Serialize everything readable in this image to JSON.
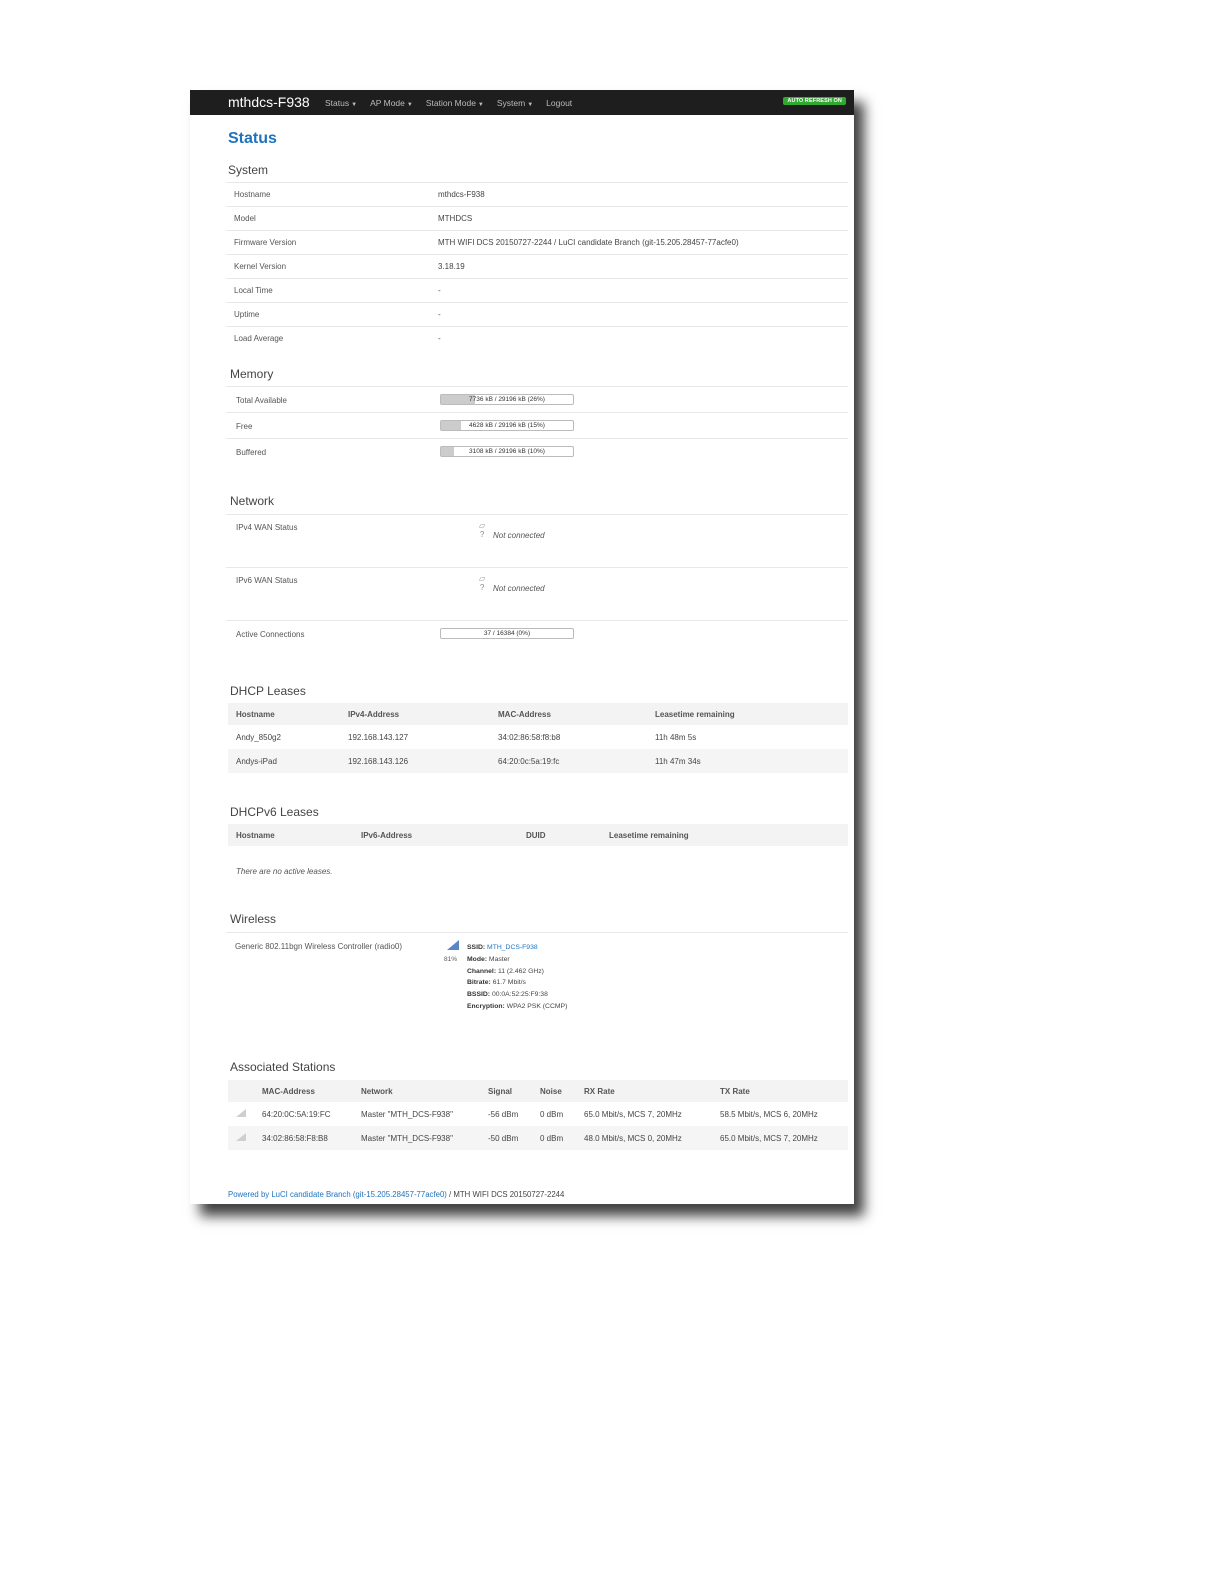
{
  "navbar": {
    "brand": "mthdcs-F938",
    "items": [
      "Status",
      "AP Mode",
      "Station Mode",
      "System",
      "Logout"
    ],
    "auto_refresh": "AUTO REFRESH ON"
  },
  "page_title": "Status",
  "system": {
    "title": "System",
    "rows": [
      {
        "label": "Hostname",
        "value": "mthdcs-F938"
      },
      {
        "label": "Model",
        "value": "MTHDCS"
      },
      {
        "label": "Firmware Version",
        "value": "MTH WIFI DCS 20150727-2244 / LuCI candidate Branch (git-15.205.28457-77acfe0)"
      },
      {
        "label": "Kernel Version",
        "value": "3.18.19"
      },
      {
        "label": "Local Time",
        "value": "-"
      },
      {
        "label": "Uptime",
        "value": "-"
      },
      {
        "label": "Load Average",
        "value": "-"
      }
    ]
  },
  "memory": {
    "title": "Memory",
    "rows": [
      {
        "label": "Total Available",
        "text": "7736 kB / 29196 kB (26%)",
        "percent": 26
      },
      {
        "label": "Free",
        "text": "4628 kB / 29196 kB (15%)",
        "percent": 15
      },
      {
        "label": "Buffered",
        "text": "3108 kB / 29196 kB (10%)",
        "percent": 10
      }
    ]
  },
  "network": {
    "title": "Network",
    "ipv4_label": "IPv4 WAN Status",
    "ipv4_status": "Not connected",
    "ipv6_label": "IPv6 WAN Status",
    "ipv6_status": "Not connected",
    "icon_glyph": "?",
    "active_label": "Active Connections",
    "active_text": "37 / 16384 (0%)",
    "active_percent": 0
  },
  "dhcp": {
    "title": "DHCP Leases",
    "headers": [
      "Hostname",
      "IPv4-Address",
      "MAC-Address",
      "Leasetime remaining"
    ],
    "rows": [
      [
        "Andy_850g2",
        "192.168.143.127",
        "34:02:86:58:f8:b8",
        "11h 48m 5s"
      ],
      [
        "Andys-iPad",
        "192.168.143.126",
        "64:20:0c:5a:19:fc",
        "11h 47m 34s"
      ]
    ]
  },
  "dhcpv6": {
    "title": "DHCPv6 Leases",
    "headers": [
      "Hostname",
      "IPv6-Address",
      "DUID",
      "Leasetime remaining"
    ],
    "empty": "There are no active leases."
  },
  "wireless": {
    "title": "Wireless",
    "device": "Generic 802.11bgn Wireless Controller (radio0)",
    "signal_pct": "81%",
    "ssid_key": "SSID:",
    "ssid": "MTH_DCS-F938",
    "mode_key": "Mode:",
    "mode": "Master",
    "channel_key": "Channel:",
    "channel": "11 (2.462 GHz)",
    "bitrate_key": "Bitrate:",
    "bitrate": "61.7 Mbit/s",
    "bssid_key": "BSSID:",
    "bssid": "00:0A:52:25:F9:38",
    "encryption_key": "Encryption:",
    "encryption": "WPA2 PSK (CCMP)"
  },
  "stations": {
    "title": "Associated Stations",
    "headers": [
      "MAC-Address",
      "Network",
      "Signal",
      "Noise",
      "RX Rate",
      "TX Rate"
    ],
    "rows": [
      [
        "64:20:0C:5A:19:FC",
        "Master \"MTH_DCS-F938\"",
        "-56 dBm",
        "0 dBm",
        "65.0 Mbit/s, MCS 7, 20MHz",
        "58.5 Mbit/s, MCS 6, 20MHz"
      ],
      [
        "34:02:86:58:F8:B8",
        "Master \"MTH_DCS-F938\"",
        "-50 dBm",
        "0 dBm",
        "48.0 Mbit/s, MCS 0, 20MHz",
        "65.0 Mbit/s, MCS 7, 20MHz"
      ]
    ]
  },
  "footer": {
    "link": "Powered by LuCI candidate Branch (git-15.205.28457-77acfe0)",
    "rest": " / MTH WIFI DCS 20150727-2244"
  },
  "colors": {
    "accent": "#1e73be",
    "navbar": "#1e1e1e",
    "refresh_badge": "#2faa2f"
  }
}
